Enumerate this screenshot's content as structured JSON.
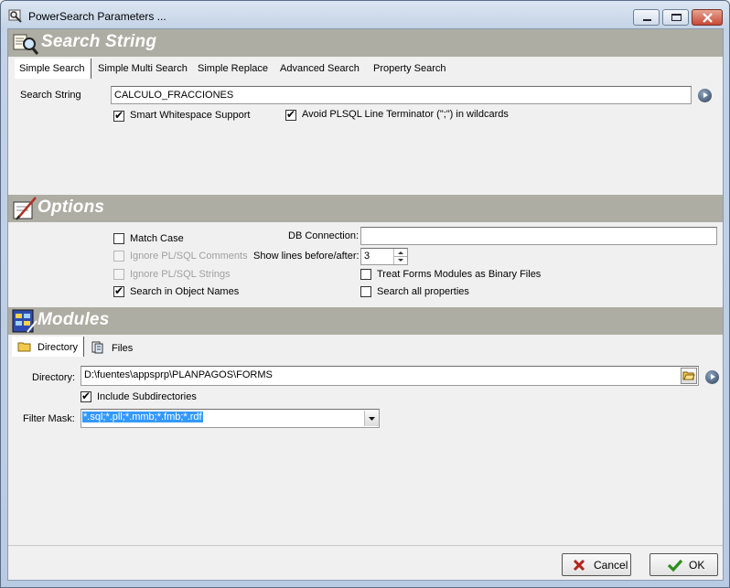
{
  "window": {
    "title": "PowerSearch Parameters ..."
  },
  "search_string": {
    "header": "Search String",
    "tabs": [
      {
        "label": "Simple Search",
        "underline": "S"
      },
      {
        "label": "Simple Multi Search",
        "underline": "M"
      },
      {
        "label": "Simple Replace",
        "underline": "R"
      },
      {
        "label": "Advanced Search",
        "underline": "A"
      },
      {
        "label": "Property Search",
        "underline": "P"
      }
    ],
    "field_label": "Search String",
    "value": "CALCULO_FRACCIONES",
    "smart_whitespace": {
      "label": "Smart Whitespace Support",
      "checked": true
    },
    "avoid_plsql": {
      "label": "Avoid PLSQL Line Terminator (\";\") in wildcards",
      "checked": true
    }
  },
  "options": {
    "header": "Options",
    "match_case": {
      "label": "Match Case",
      "checked": false
    },
    "ignore_comments": {
      "label": "Ignore PL/SQL Comments",
      "checked": false,
      "enabled": false
    },
    "ignore_strings": {
      "label": "Ignore PL/SQL Strings",
      "checked": false,
      "enabled": false
    },
    "search_object_names": {
      "label": "Search in Object Names",
      "checked": true
    },
    "db_connection": {
      "label": "DB Connection:",
      "value": ""
    },
    "show_lines": {
      "label": "Show lines before/after:",
      "value": "3"
    },
    "treat_binary": {
      "label": "Treat Forms Modules as Binary Files",
      "checked": false
    },
    "search_all_props": {
      "label": "Search all properties",
      "checked": false
    }
  },
  "modules": {
    "header": "Modules",
    "tabs": [
      {
        "label": "Directory",
        "icon": "folder-icon"
      },
      {
        "label": "Files",
        "icon": "files-icon"
      }
    ],
    "directory_label": "Directory:",
    "directory_value": "D:\\fuentes\\appsprp\\PLANPAGOS\\FORMS",
    "include_subdirs": {
      "label": "Include Subdirectories",
      "checked": true
    },
    "filter_label": "Filter Mask:",
    "filter_value": "*.sql;*.pll;*.mmb;*.fmb;*.rdf"
  },
  "buttons": {
    "cancel": "Cancel",
    "ok": "OK"
  }
}
